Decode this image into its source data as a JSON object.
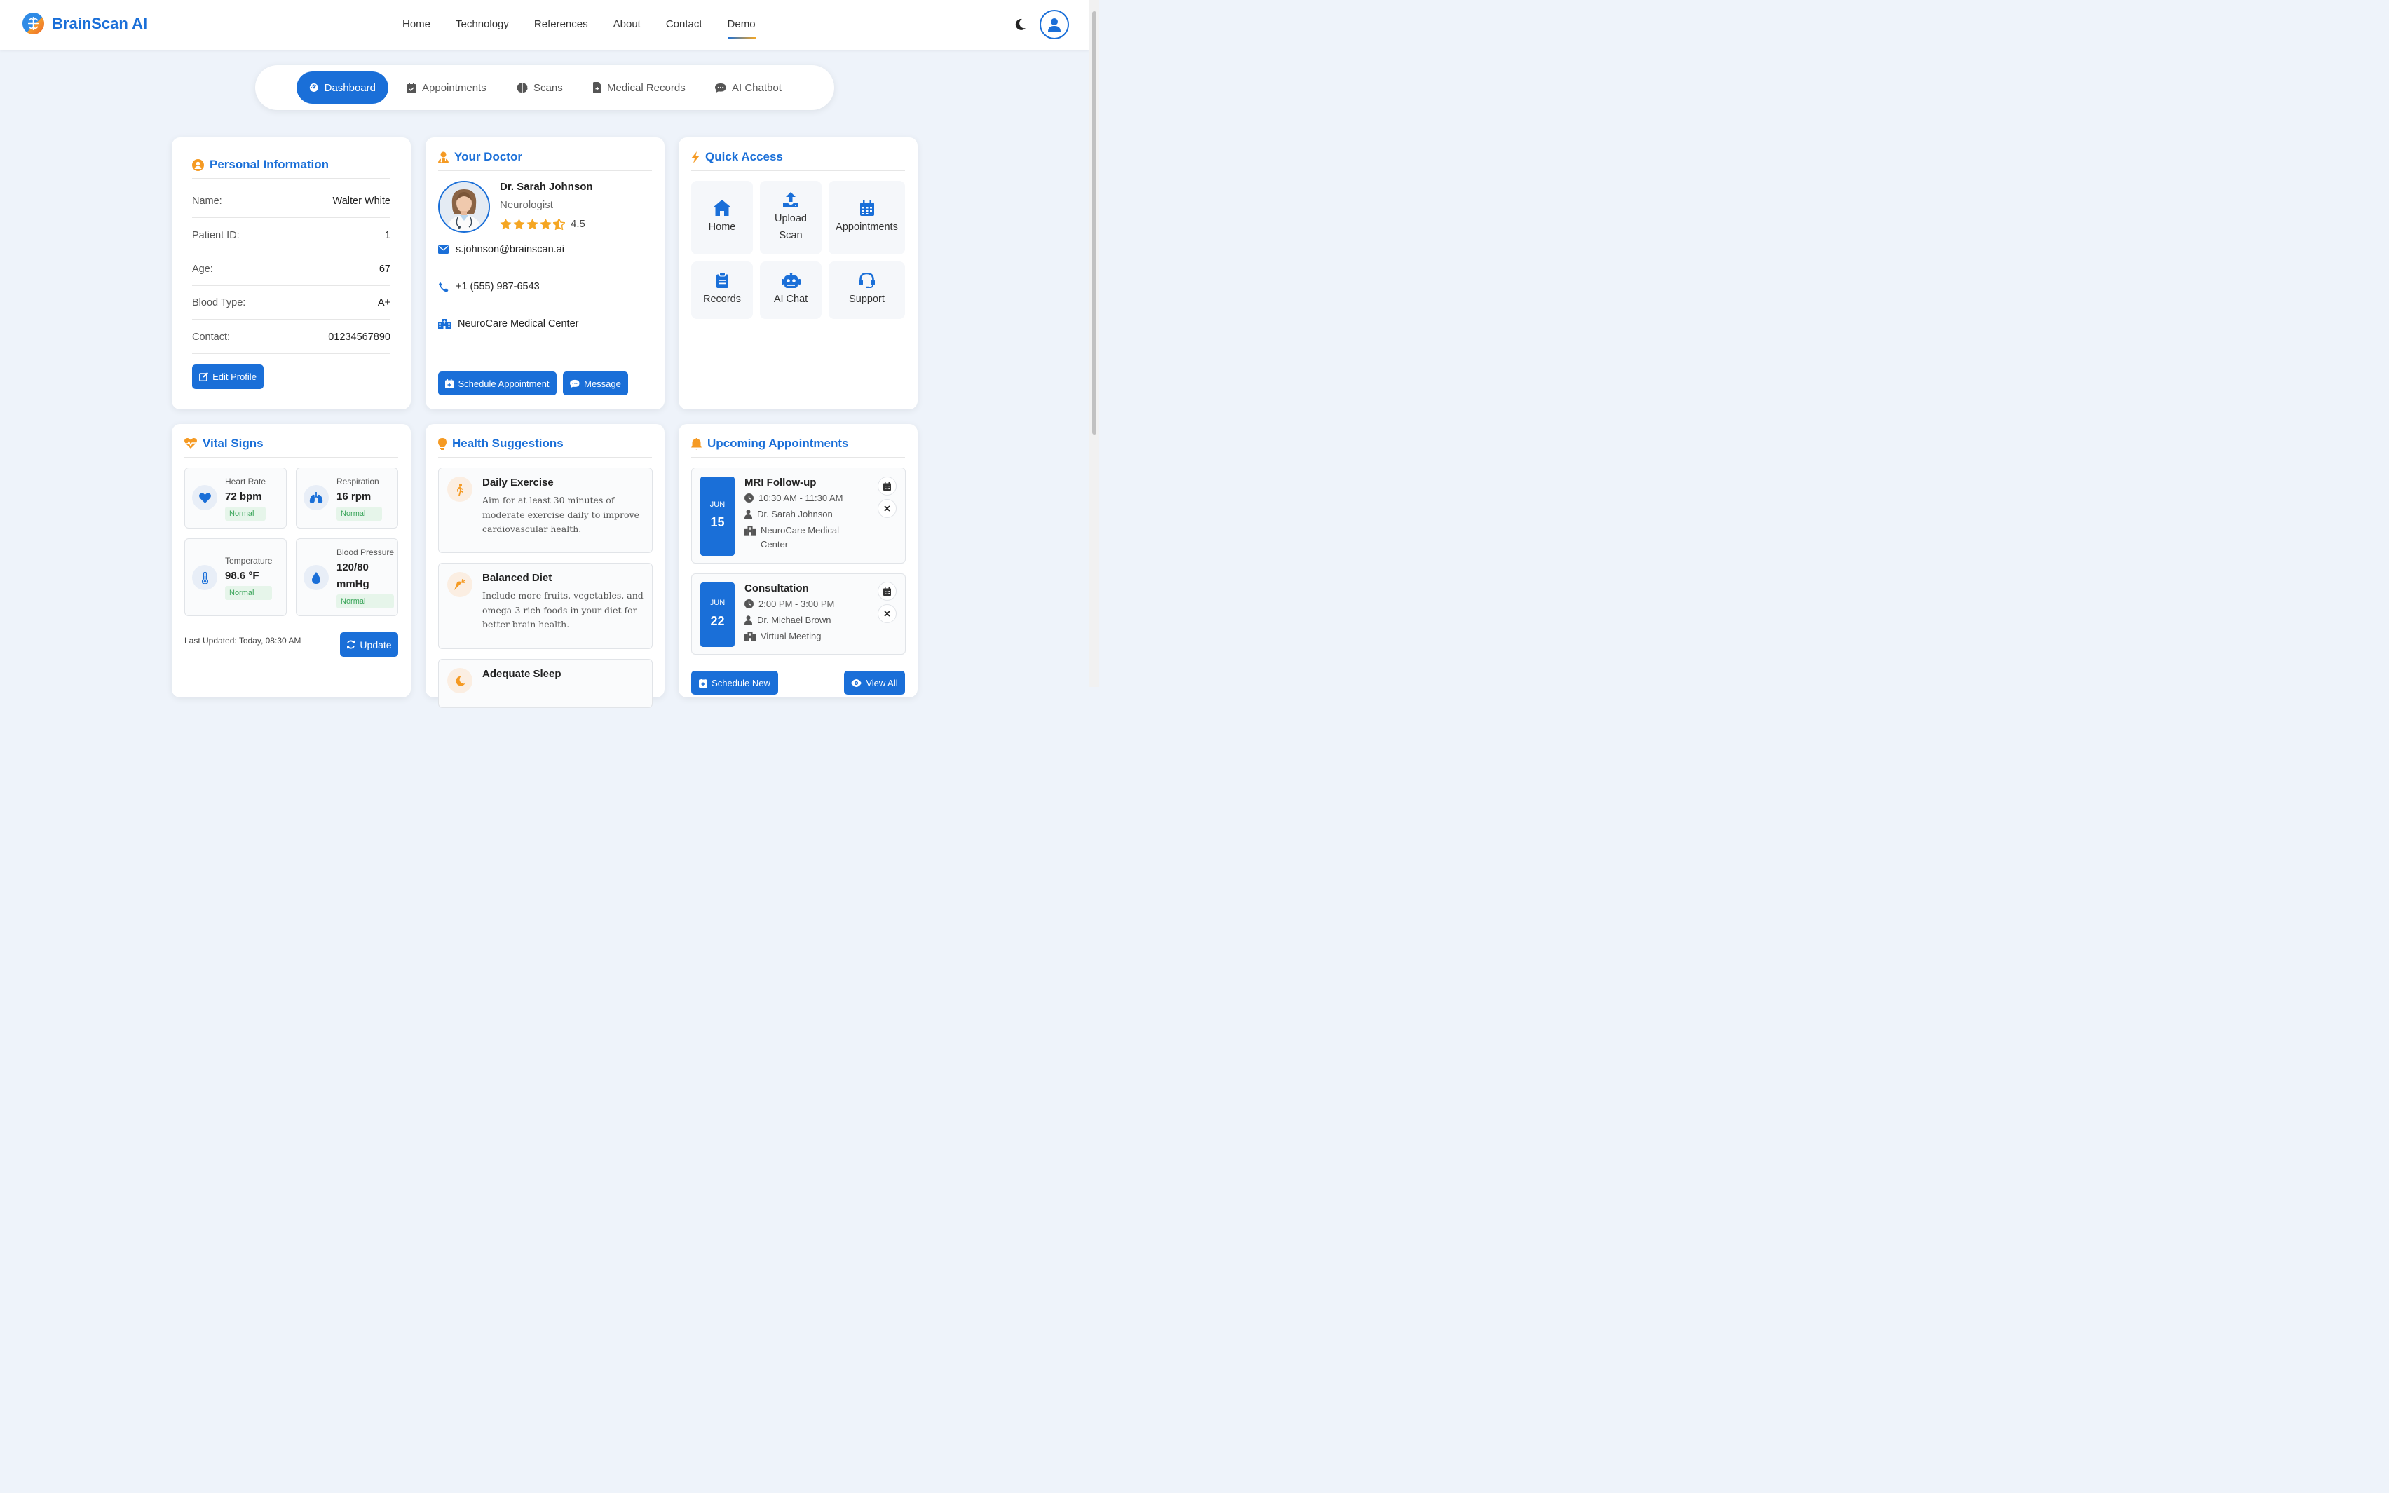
{
  "brand": {
    "name": "BrainScan AI"
  },
  "nav": {
    "links": [
      "Home",
      "Technology",
      "References",
      "About",
      "Contact",
      "Demo"
    ],
    "active": "Demo"
  },
  "tabs": [
    "Dashboard",
    "Appointments",
    "Scans",
    "Medical Records",
    "AI Chatbot"
  ],
  "personal": {
    "title": "Personal Information",
    "rows": [
      {
        "label": "Name:",
        "value": "Walter White"
      },
      {
        "label": "Patient ID:",
        "value": "1"
      },
      {
        "label": "Age:",
        "value": "67"
      },
      {
        "label": "Blood Type:",
        "value": "A+"
      },
      {
        "label": "Contact:",
        "value": "01234567890"
      }
    ],
    "edit_label": "Edit Profile"
  },
  "doctor": {
    "title": "Your Doctor",
    "name": "Dr. Sarah Johnson",
    "specialty": "Neurologist",
    "rating": 4.5,
    "rating_text": "4.5",
    "email": "s.johnson@brainscan.ai",
    "phone": "+1 (555) 987-6543",
    "clinic": "NeuroCare Medical Center",
    "schedule_label": "Schedule Appointment",
    "message_label": "Message"
  },
  "quick_access": {
    "title": "Quick Access",
    "tiles": [
      {
        "label": "Home",
        "icon": "home-icon"
      },
      {
        "label": "Upload Scan",
        "icon": "upload-icon"
      },
      {
        "label": "Appointments",
        "icon": "calendar-icon"
      },
      {
        "label": "Records",
        "icon": "clipboard-icon"
      },
      {
        "label": "AI Chat",
        "icon": "robot-icon"
      },
      {
        "label": "Support",
        "icon": "headset-icon"
      }
    ]
  },
  "vitals": {
    "title": "Vital Signs",
    "items": [
      {
        "label": "Heart Rate",
        "value": "72 bpm",
        "status": "Normal",
        "icon": "heart-icon"
      },
      {
        "label": "Respiration",
        "value": "16 rpm",
        "status": "Normal",
        "icon": "lungs-icon"
      },
      {
        "label": "Temperature",
        "value": "98.6 °F",
        "status": "Normal",
        "icon": "thermometer-icon"
      },
      {
        "label": "Blood Pressure",
        "value": "120/80 mmHg",
        "status": "Normal",
        "icon": "droplet-icon"
      }
    ],
    "last_updated": "Last Updated: Today, 08:30 AM",
    "update_label": "Update"
  },
  "suggestions": {
    "title": "Health Suggestions",
    "items": [
      {
        "title": "Daily Exercise",
        "text": "Aim for at least 30 minutes of moderate exercise daily to improve cardiovascular health.",
        "icon": "walking-icon"
      },
      {
        "title": "Balanced Diet",
        "text": "Include more fruits, vegetables, and omega-3 rich foods in your diet for better brain health.",
        "icon": "carrot-icon"
      },
      {
        "title": "Adequate Sleep",
        "text": "",
        "icon": "moon-icon"
      }
    ]
  },
  "appointments": {
    "title": "Upcoming Appointments",
    "items": [
      {
        "month": "JUN",
        "day": "15",
        "title": "MRI Follow-up",
        "time": "10:30 AM - 11:30 AM",
        "doctor": "Dr. Sarah Johnson",
        "location": "NeuroCare Medical Center"
      },
      {
        "month": "JUN",
        "day": "22",
        "title": "Consultation",
        "time": "2:00 PM - 3:00 PM",
        "doctor": "Dr. Michael Brown",
        "location": "Virtual Meeting"
      }
    ],
    "schedule_new_label": "Schedule New",
    "view_all_label": "View All"
  },
  "colors": {
    "primary": "#1a6fd8",
    "accent": "#f5a623",
    "success": "#3aa55a",
    "background": "#eef3fa"
  }
}
